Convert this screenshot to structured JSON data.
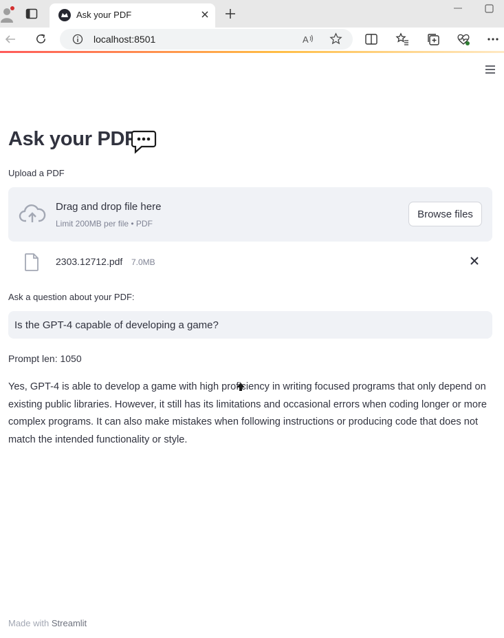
{
  "browser": {
    "tab_title": "Ask your PDF",
    "url": "localhost:8501"
  },
  "page": {
    "title": "Ask your PDF",
    "title_emoji": "speech-balloon-icon",
    "upload_label": "Upload a PDF",
    "dropzone_main": "Drag and drop file here",
    "dropzone_sub": "Limit 200MB per file • PDF",
    "browse_label": "Browse files",
    "file": {
      "name": "2303.12712.pdf",
      "size": "7.0MB"
    },
    "question_label": "Ask a question about your PDF:",
    "question_value": "Is the GPT-4 capable of developing a game?",
    "prompt_len": "Prompt len: 1050",
    "answer": "Yes, GPT-4 is able to develop a game with high proficiency in writing focused programs that only depend on existing public libraries. However, it still has its limitations and occasional errors when coding longer or more complex programs. It can also make mistakes when following instructions or producing code that does not match the intended functionality or style.",
    "footer_prefix": "Made with ",
    "footer_brand": "Streamlit"
  },
  "colors": {
    "text": "#31333f",
    "secondary_bg": "#f0f2f6",
    "muted": "#808495"
  }
}
